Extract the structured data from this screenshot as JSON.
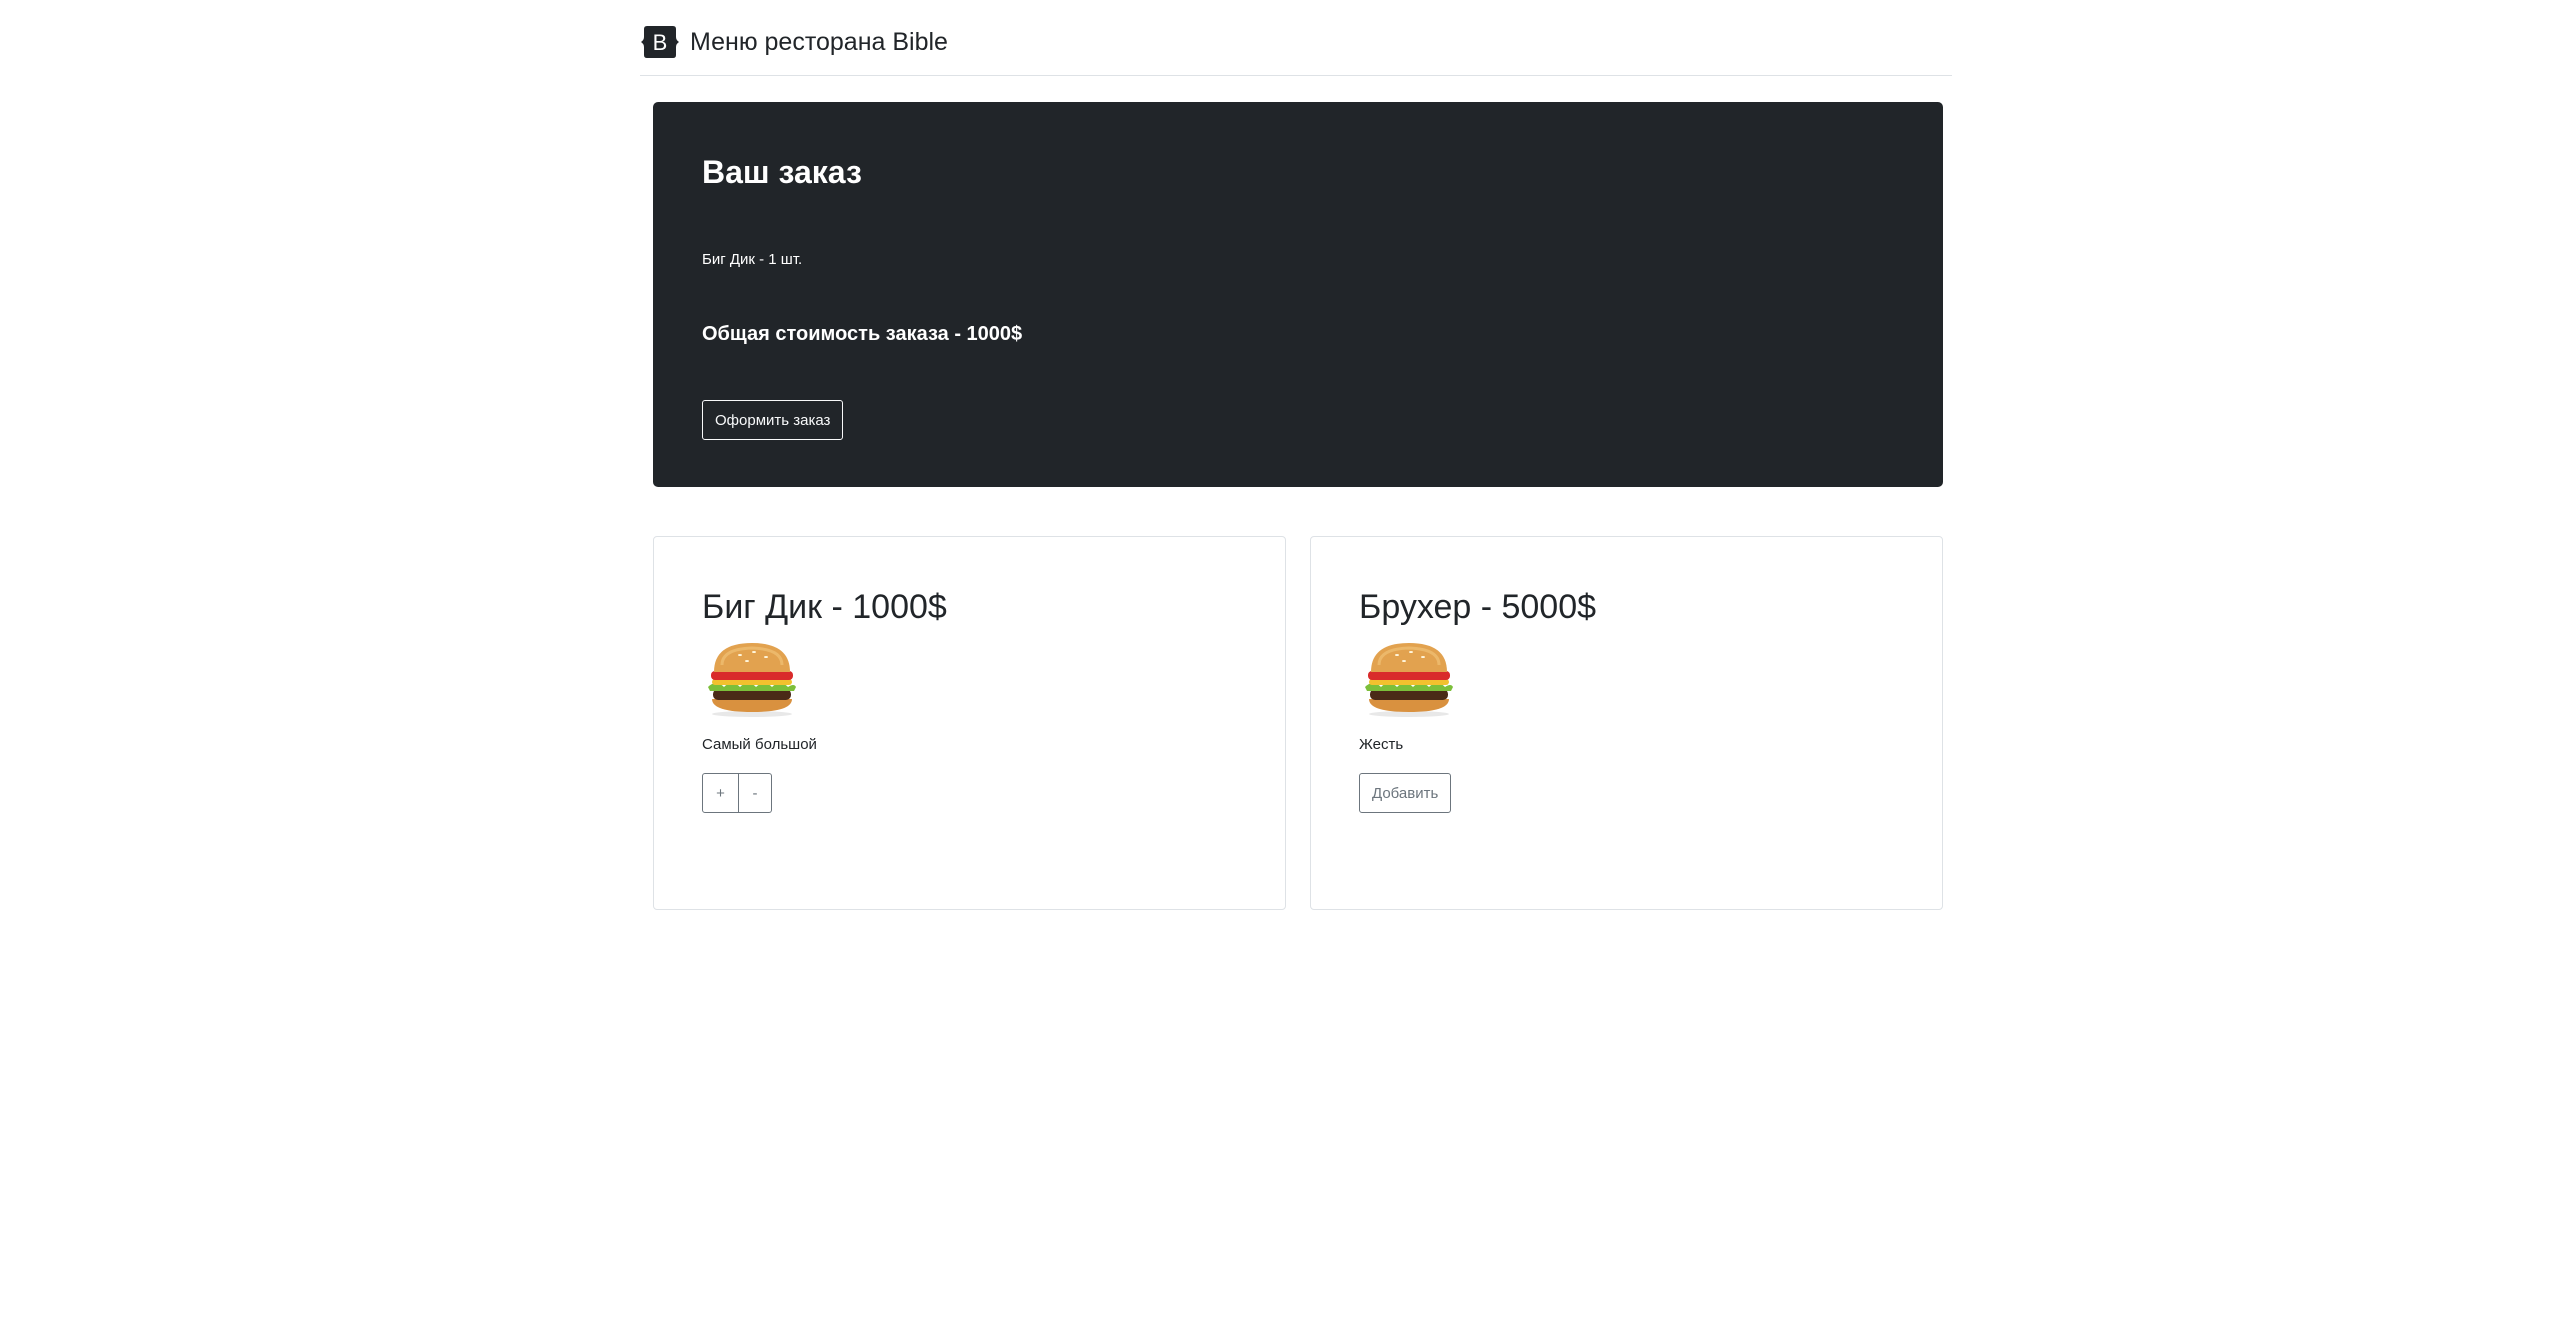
{
  "header": {
    "brand_letter": "B",
    "brand_text": "Меню ресторана Bible"
  },
  "order": {
    "title": "Ваш заказ",
    "items": [
      {
        "text": "Биг Дик - 1 шт."
      }
    ],
    "total_text": "Общая стоимость заказа - 1000$",
    "checkout_label": "Оформить заказ"
  },
  "products": [
    {
      "title": "Биг Дик - 1000$",
      "description": "Самый большой",
      "plus_label": "+",
      "minus_label": "-"
    },
    {
      "title": "Брухер - 5000$",
      "description": "Жесть",
      "add_label": "Добавить"
    }
  ],
  "colors": {
    "panel_bg": "#212529",
    "text_dark": "#212529",
    "muted": "#6c757d",
    "border": "#dee2e6"
  }
}
